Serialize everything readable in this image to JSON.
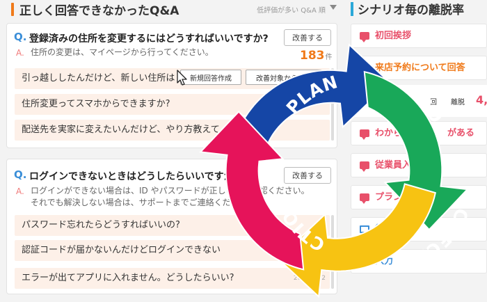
{
  "left": {
    "title": "正しく回答できなかったQ&A",
    "sort_label": "低評価が多い Q&A 順",
    "card1": {
      "q_mark": "Q.",
      "question": "登録済みの住所を変更するにはどうすればいいですか?",
      "improve": "改善する",
      "a_mark": "A.",
      "answer": "住所の変更は、マイページから行ってください。",
      "count": "183",
      "count_unit": "件",
      "items": [
        "引っ越ししたんだけど、新しい住所は",
        "住所変更ってスマホからできますか?",
        "配送先を実家に変えたいんだけど、やり方教えて"
      ],
      "popup": {
        "new_answer": "新規回答作成",
        "exclude": "改善対象から外す"
      }
    },
    "card2": {
      "q_mark": "Q.",
      "question": "ログインできないときはどうしたらいいですか?",
      "improve": "改善する",
      "a_mark": "A.",
      "answer_line1": "ログインができない場合は、ID やパスワードが正しいかご確認ください。",
      "answer_line2": "それでも解決しない場合は、サポートまでご連絡ください。",
      "items": [
        "パスワード忘れたらどうすればいいの?",
        "認証コードが届かないんだけどログインできない",
        "エラーが出てアプリに入れません。どうしたらいい?"
      ],
      "date": "2025/05/2"
    }
  },
  "right": {
    "title": "シナリオ毎の離脱率",
    "items": [
      {
        "label": "初回挨拶"
      },
      {
        "label": "来店予約について回答"
      },
      {
        "label": "わからない　　　がある"
      },
      {
        "label": "従業員入力"
      },
      {
        "label": "プランについて"
      },
      {
        "label": "従業員"
      },
      {
        "label": "入力"
      }
    ],
    "stats": {
      "label1": "回",
      "label2": "離脱",
      "num": "4,"
    }
  },
  "pdca": {
    "plan": "PLAN",
    "do": "DO",
    "check": "CHECK",
    "action": "ACTION",
    "colors": {
      "plan": "#1546a6",
      "do": "#19a859",
      "check": "#f7c312",
      "action": "#e6135a"
    }
  }
}
